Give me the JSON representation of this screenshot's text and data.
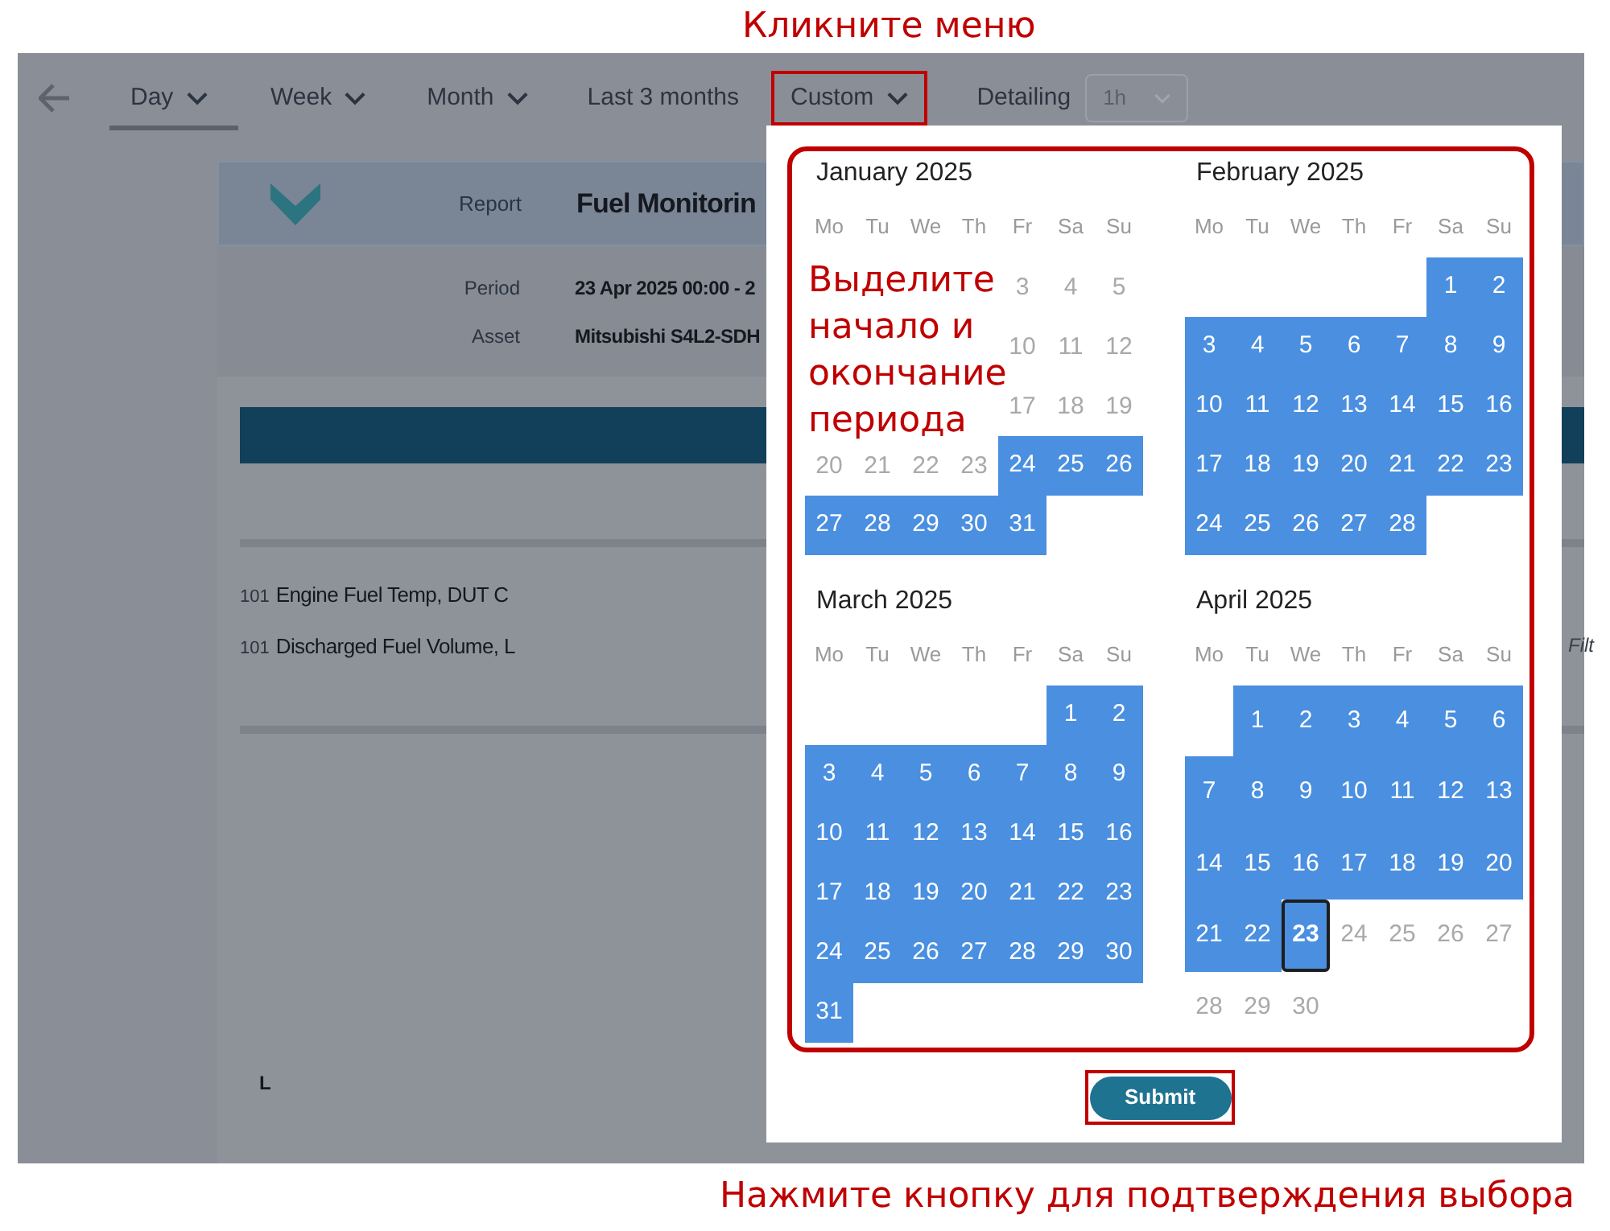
{
  "annotations": {
    "top": "Кликните меню",
    "range_hint": "Выделите начало и окончание периода",
    "bottom": "Нажмите кнопку для подтверждения выбора"
  },
  "toolbar": {
    "items": [
      {
        "label": "Day",
        "selected": true,
        "dropdown": true,
        "highlighted": false
      },
      {
        "label": "Week",
        "selected": false,
        "dropdown": true,
        "highlighted": false
      },
      {
        "label": "Month",
        "selected": false,
        "dropdown": true,
        "highlighted": false
      },
      {
        "label": "Last 3 months",
        "selected": false,
        "dropdown": false,
        "highlighted": false
      },
      {
        "label": "Custom",
        "selected": false,
        "dropdown": true,
        "highlighted": true
      }
    ],
    "detailing": {
      "label": "Detailing",
      "value": "1h"
    }
  },
  "report": {
    "header_label": "Report",
    "title": "Fuel Monitorin",
    "fields": [
      {
        "label": "Period",
        "value": "23 Apr 2025 00:00 - 2"
      },
      {
        "label": "Asset",
        "value": "Mitsubishi S4L2-SDH"
      }
    ],
    "series": [
      {
        "index": "101",
        "name": "Engine Fuel Temp, DUT C"
      },
      {
        "index": "101",
        "name": "Discharged Fuel Volume, L"
      }
    ],
    "side_text": "Filt",
    "axis_label": "L"
  },
  "calendar": {
    "months": [
      {
        "title": "January 2025",
        "weekdays": [
          "Mo",
          "Tu",
          "We",
          "Th",
          "Fr",
          "Sa",
          "Su"
        ],
        "weeks": [
          [
            {
              "kind": "empty"
            },
            {
              "kind": "empty"
            },
            {
              "kind": "empty"
            },
            {
              "kind": "empty"
            },
            {
              "kind": "day",
              "day": "3",
              "selected": false,
              "focused": false
            },
            {
              "day": "4",
              "selected": false,
              "focused": false
            },
            {
              "day": "5",
              "selected": false,
              "focused": false
            }
          ],
          [
            {
              "kind": "empty"
            },
            {
              "kind": "empty"
            },
            {
              "kind": "empty"
            },
            {
              "kind": "empty"
            },
            {
              "kind": "day",
              "day": "10",
              "selected": false,
              "focused": false
            },
            {
              "day": "11",
              "selected": false,
              "focused": false
            },
            {
              "day": "12",
              "selected": false,
              "focused": false
            }
          ],
          [
            {
              "kind": "empty"
            },
            {
              "kind": "empty"
            },
            {
              "kind": "empty"
            },
            {
              "kind": "empty"
            },
            {
              "kind": "day",
              "day": "17",
              "selected": false,
              "focused": false
            },
            {
              "day": "18",
              "selected": false,
              "focused": false
            },
            {
              "day": "19",
              "selected": false,
              "focused": false
            }
          ],
          [
            {
              "day": "20",
              "selected": false,
              "focused": false
            },
            {
              "day": "21",
              "selected": false,
              "focused": false
            },
            {
              "day": "22",
              "selected": false,
              "focused": false
            },
            {
              "day": "23",
              "selected": false,
              "focused": false
            },
            {
              "day": "24",
              "selected": true,
              "focused": false
            },
            {
              "day": "25",
              "selected": true,
              "focused": false
            },
            {
              "day": "26",
              "selected": true,
              "focused": false
            }
          ],
          [
            {
              "day": "27",
              "selected": true,
              "focused": false
            },
            {
              "day": "28",
              "selected": true,
              "focused": false
            },
            {
              "day": "29",
              "selected": true,
              "focused": false
            },
            {
              "day": "30",
              "selected": true,
              "focused": false
            },
            {
              "day": "31",
              "selected": true,
              "focused": false
            },
            {
              "kind": "empty"
            },
            {
              "kind": "empty"
            }
          ]
        ]
      },
      {
        "title": "February 2025",
        "weekdays": [
          "Mo",
          "Tu",
          "We",
          "Th",
          "Fr",
          "Sa",
          "Su"
        ],
        "weeks": [
          [
            {
              "kind": "empty"
            },
            {
              "kind": "empty"
            },
            {
              "kind": "empty"
            },
            {
              "kind": "empty"
            },
            {
              "kind": "empty"
            },
            {
              "day": "1",
              "selected": true,
              "focused": false
            },
            {
              "day": "2",
              "selected": true,
              "focused": false
            }
          ],
          [
            {
              "day": "3",
              "selected": true,
              "focused": false
            },
            {
              "day": "4",
              "selected": true,
              "focused": false
            },
            {
              "day": "5",
              "selected": true,
              "focused": false
            },
            {
              "day": "6",
              "selected": true,
              "focused": false
            },
            {
              "day": "7",
              "selected": true,
              "focused": false
            },
            {
              "day": "8",
              "selected": true,
              "focused": false
            },
            {
              "day": "9",
              "selected": true,
              "focused": false
            }
          ],
          [
            {
              "day": "10",
              "selected": true,
              "focused": false
            },
            {
              "day": "11",
              "selected": true,
              "focused": false
            },
            {
              "day": "12",
              "selected": true,
              "focused": false
            },
            {
              "day": "13",
              "selected": true,
              "focused": false
            },
            {
              "day": "14",
              "selected": true,
              "focused": false
            },
            {
              "day": "15",
              "selected": true,
              "focused": false
            },
            {
              "day": "16",
              "selected": true,
              "focused": false
            }
          ],
          [
            {
              "day": "17",
              "selected": true,
              "focused": false
            },
            {
              "day": "18",
              "selected": true,
              "focused": false
            },
            {
              "day": "19",
              "selected": true,
              "focused": false
            },
            {
              "day": "20",
              "selected": true,
              "focused": false
            },
            {
              "day": "21",
              "selected": true,
              "focused": false
            },
            {
              "day": "22",
              "selected": true,
              "focused": false
            },
            {
              "day": "23",
              "selected": true,
              "focused": false
            }
          ],
          [
            {
              "day": "24",
              "selected": true,
              "focused": false
            },
            {
              "day": "25",
              "selected": true,
              "focused": false
            },
            {
              "day": "26",
              "selected": true,
              "focused": false
            },
            {
              "day": "27",
              "selected": true,
              "focused": false
            },
            {
              "day": "28",
              "selected": true,
              "focused": false
            },
            {
              "kind": "empty"
            },
            {
              "kind": "empty"
            }
          ]
        ]
      },
      {
        "title": "March 2025",
        "weekdays": [
          "Mo",
          "Tu",
          "We",
          "Th",
          "Fr",
          "Sa",
          "Su"
        ],
        "weeks": [
          [
            {
              "kind": "empty"
            },
            {
              "kind": "empty"
            },
            {
              "kind": "empty"
            },
            {
              "kind": "empty"
            },
            {
              "kind": "empty"
            },
            {
              "day": "1",
              "selected": true,
              "focused": false
            },
            {
              "day": "2",
              "selected": true,
              "focused": false
            }
          ],
          [
            {
              "day": "3",
              "selected": true,
              "focused": false
            },
            {
              "day": "4",
              "selected": true,
              "focused": false
            },
            {
              "day": "5",
              "selected": true,
              "focused": false
            },
            {
              "day": "6",
              "selected": true,
              "focused": false
            },
            {
              "day": "7",
              "selected": true,
              "focused": false
            },
            {
              "day": "8",
              "selected": true,
              "focused": false
            },
            {
              "day": "9",
              "selected": true,
              "focused": false
            }
          ],
          [
            {
              "day": "10",
              "selected": true,
              "focused": false
            },
            {
              "day": "11",
              "selected": true,
              "focused": false
            },
            {
              "day": "12",
              "selected": true,
              "focused": false
            },
            {
              "day": "13",
              "selected": true,
              "focused": false
            },
            {
              "day": "14",
              "selected": true,
              "focused": false
            },
            {
              "day": "15",
              "selected": true,
              "focused": false
            },
            {
              "day": "16",
              "selected": true,
              "focused": false
            }
          ],
          [
            {
              "day": "17",
              "selected": true,
              "focused": false
            },
            {
              "day": "18",
              "selected": true,
              "focused": false
            },
            {
              "day": "19",
              "selected": true,
              "focused": false
            },
            {
              "day": "20",
              "selected": true,
              "focused": false
            },
            {
              "day": "21",
              "selected": true,
              "focused": false
            },
            {
              "day": "22",
              "selected": true,
              "focused": false
            },
            {
              "day": "23",
              "selected": true,
              "focused": false
            }
          ],
          [
            {
              "day": "24",
              "selected": true,
              "focused": false
            },
            {
              "day": "25",
              "selected": true,
              "focused": false
            },
            {
              "day": "26",
              "selected": true,
              "focused": false
            },
            {
              "day": "27",
              "selected": true,
              "focused": false
            },
            {
              "day": "28",
              "selected": true,
              "focused": false
            },
            {
              "day": "29",
              "selected": true,
              "focused": false
            },
            {
              "day": "30",
              "selected": true,
              "focused": false
            }
          ],
          [
            {
              "day": "31",
              "selected": true,
              "focused": false
            },
            {
              "kind": "empty"
            },
            {
              "kind": "empty"
            },
            {
              "kind": "empty"
            },
            {
              "kind": "empty"
            },
            {
              "kind": "empty"
            },
            {
              "kind": "empty"
            }
          ]
        ]
      },
      {
        "title": "April 2025",
        "weekdays": [
          "Mo",
          "Tu",
          "We",
          "Th",
          "Fr",
          "Sa",
          "Su"
        ],
        "weeks": [
          [
            {
              "kind": "empty"
            },
            {
              "day": "1",
              "selected": true,
              "focused": false
            },
            {
              "day": "2",
              "selected": true,
              "focused": false
            },
            {
              "day": "3",
              "selected": true,
              "focused": false
            },
            {
              "day": "4",
              "selected": true,
              "focused": false
            },
            {
              "day": "5",
              "selected": true,
              "focused": false
            },
            {
              "day": "6",
              "selected": true,
              "focused": false
            }
          ],
          [
            {
              "day": "7",
              "selected": true,
              "focused": false
            },
            {
              "day": "8",
              "selected": true,
              "focused": false
            },
            {
              "day": "9",
              "selected": true,
              "focused": false
            },
            {
              "day": "10",
              "selected": true,
              "focused": false
            },
            {
              "day": "11",
              "selected": true,
              "focused": false
            },
            {
              "day": "12",
              "selected": true,
              "focused": false
            },
            {
              "day": "13",
              "selected": true,
              "focused": false
            }
          ],
          [
            {
              "day": "14",
              "selected": true,
              "focused": false
            },
            {
              "day": "15",
              "selected": true,
              "focused": false
            },
            {
              "day": "16",
              "selected": true,
              "focused": false
            },
            {
              "day": "17",
              "selected": true,
              "focused": false
            },
            {
              "day": "18",
              "selected": true,
              "focused": false
            },
            {
              "day": "19",
              "selected": true,
              "focused": false
            },
            {
              "day": "20",
              "selected": true,
              "focused": false
            }
          ],
          [
            {
              "day": "21",
              "selected": true,
              "focused": false
            },
            {
              "day": "22",
              "selected": true,
              "focused": false
            },
            {
              "day": "23",
              "selected": true,
              "focused": true
            },
            {
              "day": "24",
              "selected": false,
              "focused": false
            },
            {
              "day": "25",
              "selected": false,
              "focused": false
            },
            {
              "day": "26",
              "selected": false,
              "focused": false
            },
            {
              "day": "27",
              "selected": false,
              "focused": false
            }
          ],
          [
            {
              "day": "28",
              "selected": false,
              "focused": false
            },
            {
              "day": "29",
              "selected": false,
              "focused": false
            },
            {
              "day": "30",
              "selected": false,
              "focused": false
            },
            {
              "kind": "empty"
            },
            {
              "kind": "empty"
            },
            {
              "kind": "empty"
            },
            {
              "kind": "empty"
            }
          ]
        ]
      }
    ],
    "submit": {
      "label": "Submit",
      "highlighted": true
    }
  }
}
